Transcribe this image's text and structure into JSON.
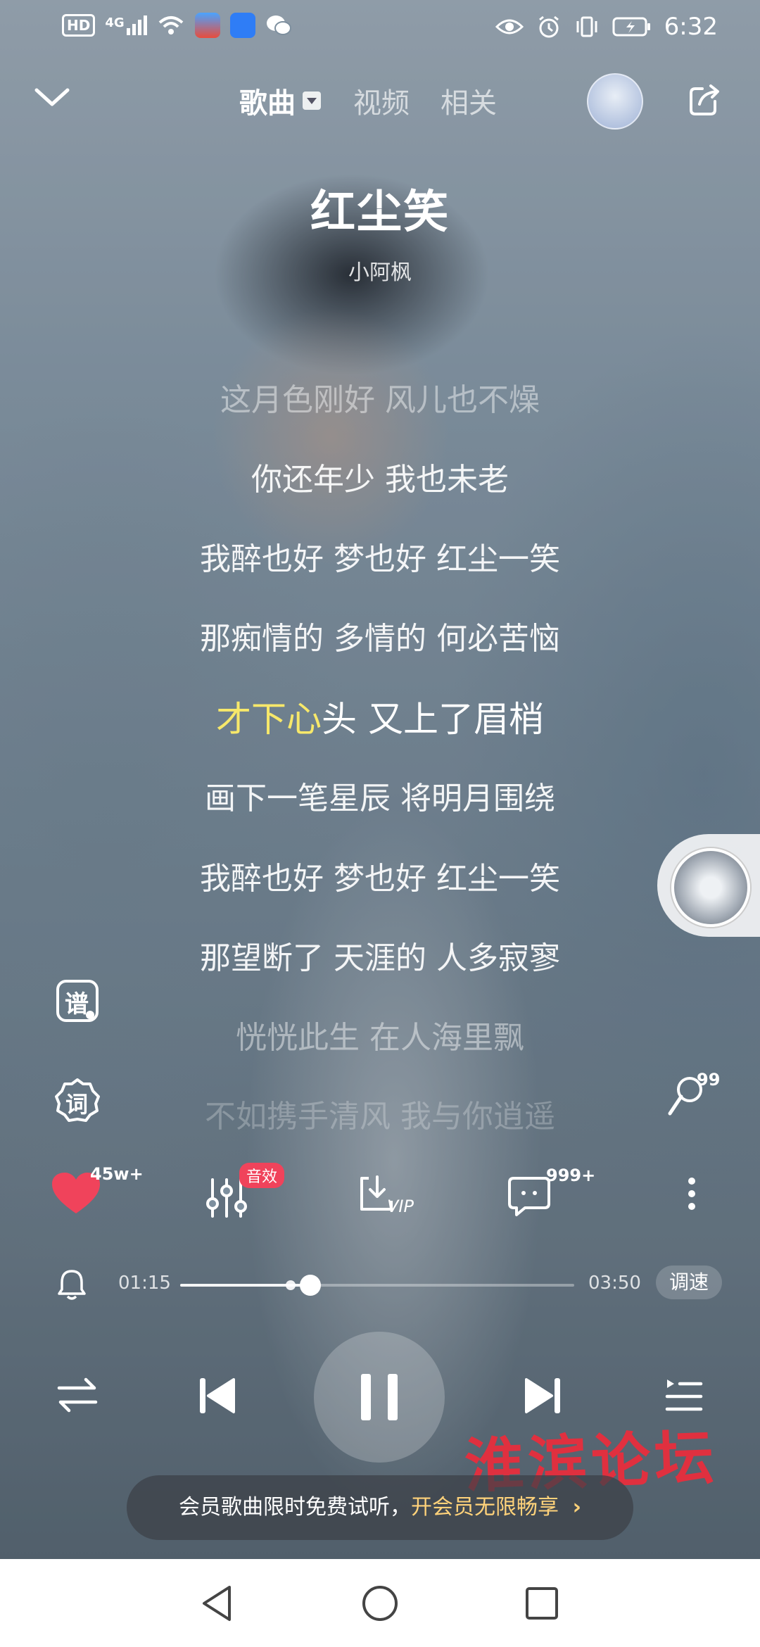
{
  "status_bar": {
    "left_badges": [
      "HD",
      "4G"
    ],
    "time": "6:32"
  },
  "nav": {
    "tabs": [
      {
        "label": "歌曲",
        "active": true
      },
      {
        "label": "视频",
        "active": false
      },
      {
        "label": "相关",
        "active": false
      }
    ]
  },
  "song": {
    "title": "红尘笑",
    "artist": "小阿枫"
  },
  "lyrics": [
    {
      "text": "这月色刚好 风儿也不燥",
      "state": "dim"
    },
    {
      "text": "你还年少 我也未老",
      "state": "normal"
    },
    {
      "text": "我醉也好 梦也好 红尘一笑",
      "state": "normal"
    },
    {
      "text": "那痴情的 多情的 何必苦恼",
      "state": "normal"
    },
    {
      "text_sung": "才下心",
      "text_unsung": "头 又上了眉梢",
      "state": "active"
    },
    {
      "text": "画下一笔星辰 将明月围绕",
      "state": "normal"
    },
    {
      "text": "我醉也好 梦也好 红尘一笑",
      "state": "normal"
    },
    {
      "text": "那望断了 天涯的 人多寂寥",
      "state": "normal"
    },
    {
      "text": "恍恍此生 在人海里飘",
      "state": "dim"
    },
    {
      "text": "不如携手清风 我与你逍遥",
      "state": "fade"
    }
  ],
  "side": {
    "score_label": "谱",
    "lyrics_label": "词",
    "comment_badge": "99"
  },
  "actions": {
    "like_count": "45w+",
    "effects_badge": "音效",
    "download_label": "VIP",
    "comments_count": "999+"
  },
  "progress": {
    "current": "01:15",
    "total": "03:50",
    "fraction": 0.3304,
    "buffered_fraction": 0.28,
    "speed_label": "调速"
  },
  "watermark": "淮滨论坛",
  "promo": {
    "text_plain": "会员歌曲限时免费试听，",
    "text_link": "开会员无限畅享"
  },
  "colors": {
    "active_lyric": "#f7e86a",
    "like_heart": "#f0435b",
    "promo_link": "#ffd27a",
    "watermark": "#e0303f"
  }
}
